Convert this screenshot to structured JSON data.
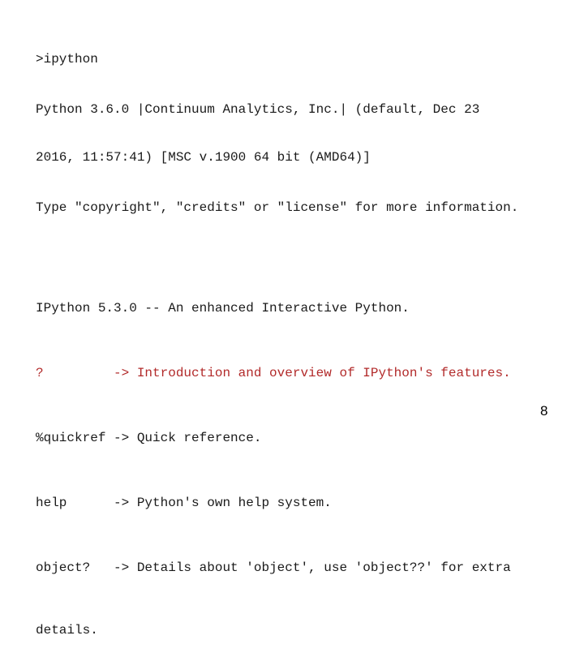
{
  "terminal": {
    "command": ">ipython",
    "python_banner": [
      "Python 3.6.0 |Continuum Analytics, Inc.| (default, Dec 23",
      "2016, 11:57:41) [MSC v.1900 64 bit (AMD64)]"
    ],
    "type_hint": "Type \"copyright\", \"credits\" or \"license\" for more information.",
    "ipython_banner": "IPython 5.3.0 -- An enhanced Interactive Python.",
    "help_lines": [
      {
        "key": "?         ",
        "arrow": "->",
        "text": " Introduction and overview of IPython's features."
      },
      {
        "key": "%quickref ",
        "arrow": "->",
        "text": " Quick reference."
      },
      {
        "key": "help      ",
        "arrow": "->",
        "text": " Python's own help system."
      },
      {
        "key": "object?   ",
        "arrow": "->",
        "text": " Details about 'object', use 'object??' for extra"
      }
    ],
    "continuation": "details.",
    "highlight_color": "#b22a2a"
  },
  "slide": {
    "page_number": "8"
  }
}
